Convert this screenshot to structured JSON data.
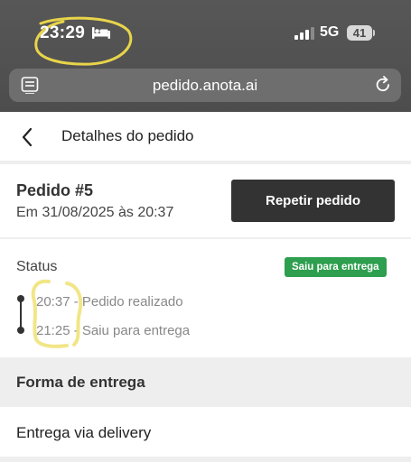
{
  "status_bar": {
    "time": "23:29",
    "network": "5G",
    "battery": "41"
  },
  "browser": {
    "url": "pedido.anota.ai"
  },
  "header": {
    "title": "Detalhes do pedido"
  },
  "order": {
    "title": "Pedido #5",
    "date": "Em 31/08/2025 às 20:37",
    "repeat_label": "Repetir pedido"
  },
  "status": {
    "label": "Status",
    "badge": "Saiu para entrega",
    "badge_color": "#2e9e4f",
    "timeline": [
      {
        "text": "20:37 - Pedido realizado"
      },
      {
        "text": "21:25 - Saiu para entrega"
      }
    ]
  },
  "delivery": {
    "section_title": "Forma de entrega",
    "method": "Entrega via delivery"
  },
  "icons": {
    "sleep": "bed-icon",
    "signal": "signal-icon",
    "tabs": "tabs-icon",
    "reload": "reload-icon",
    "back": "back-icon"
  }
}
